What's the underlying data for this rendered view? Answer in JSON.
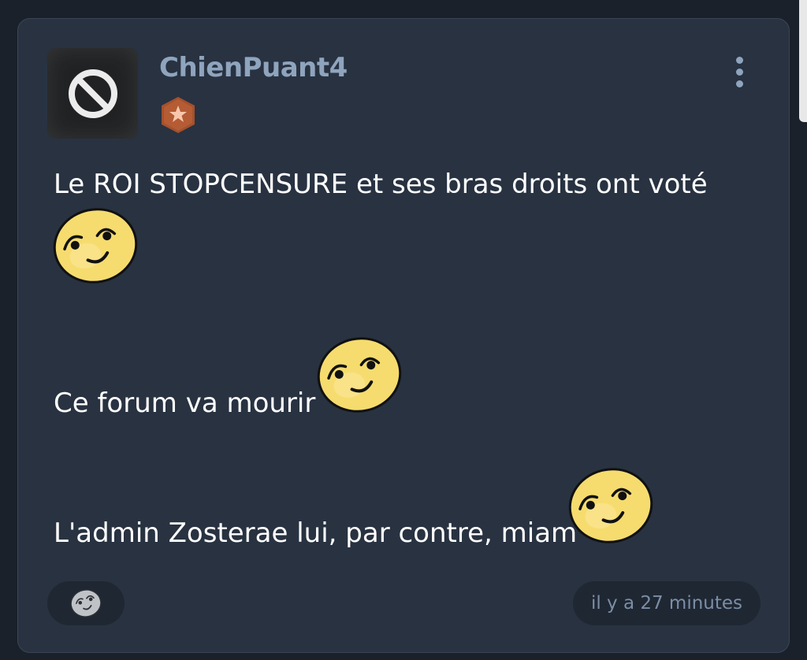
{
  "post": {
    "author": "ChienPuant4",
    "author_avatar_icon": "prohibited-sign-icon",
    "rank_badge_icon": "star-hexagon-badge-icon",
    "menu_icon": "vertical-ellipsis-icon",
    "body": {
      "line1": "Le ROI STOPCENSURE et ses bras droits ont voté",
      "line2": "Ce forum va mourir",
      "line3": "L'admin Zosterae lui, par contre, miam"
    },
    "emoji_icon": "smirking-face-emoji",
    "reaction_icon": "add-reaction-smiley-icon",
    "timestamp": "il y a 27 minutes"
  },
  "colors": {
    "page_bg": "#1a212b",
    "card_bg": "#283241",
    "username": "#8fa4bd",
    "text": "#ffffff",
    "pill_bg": "#1f2733",
    "timestamp": "#7b8ea5",
    "badge": "#a4512e",
    "emoji_yellow": "#f6dc6e"
  }
}
